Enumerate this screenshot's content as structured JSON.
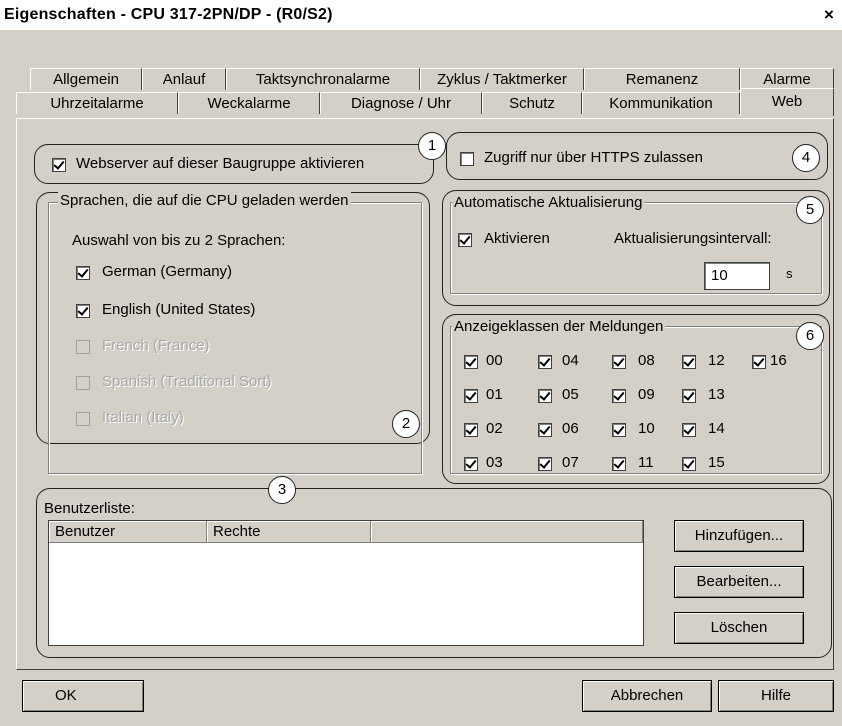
{
  "window": {
    "title": "Eigenschaften - CPU 317-2PN/DP - (R0/S2)",
    "close": "×"
  },
  "tabs_row1": [
    "Allgemein",
    "Anlauf",
    "Taktsynchronalarme",
    "Zyklus / Taktmerker",
    "Remanenz",
    "Alarme"
  ],
  "tabs_row2": [
    "Uhrzeitalarme",
    "Weckalarme",
    "Diagnose / Uhr",
    "Schutz",
    "Kommunikation",
    "Web"
  ],
  "webserver": {
    "label": "Webserver auf dieser Baugruppe aktivieren",
    "checked": true
  },
  "https": {
    "label": "Zugriff nur über HTTPS zulassen",
    "checked": false
  },
  "languages": {
    "legend": "Sprachen, die auf die CPU geladen werden",
    "hint": "Auswahl von bis zu 2 Sprachen:",
    "items": [
      {
        "label": "German (Germany)",
        "checked": true,
        "enabled": true
      },
      {
        "label": "English (United States)",
        "checked": true,
        "enabled": true
      },
      {
        "label": "French (France)",
        "checked": false,
        "enabled": false
      },
      {
        "label": "Spanish (Traditional Sort)",
        "checked": false,
        "enabled": false
      },
      {
        "label": "Italian (Italy)",
        "checked": false,
        "enabled": false
      }
    ]
  },
  "autoupdate": {
    "legend": "Automatische Aktualisierung",
    "activate_label": "Aktivieren",
    "activate_checked": true,
    "interval_label": "Aktualisierungsintervall:",
    "interval_value": "10",
    "interval_unit": "s"
  },
  "msgclasses": {
    "legend": "Anzeigeklassen der Meldungen",
    "items": [
      "00",
      "04",
      "08",
      "12",
      "16",
      "01",
      "05",
      "09",
      "13",
      "02",
      "06",
      "10",
      "14",
      "03",
      "07",
      "11",
      "15"
    ]
  },
  "users": {
    "legend": "Benutzerliste:",
    "columns": [
      "Benutzer",
      "Rechte",
      ""
    ],
    "add": "Hinzufügen...",
    "edit": "Bearbeiten...",
    "delete": "Löschen"
  },
  "callouts": [
    "1",
    "2",
    "3",
    "4",
    "5",
    "6"
  ],
  "footer": {
    "ok": "OK",
    "cancel": "Abbrechen",
    "help": "Hilfe"
  }
}
